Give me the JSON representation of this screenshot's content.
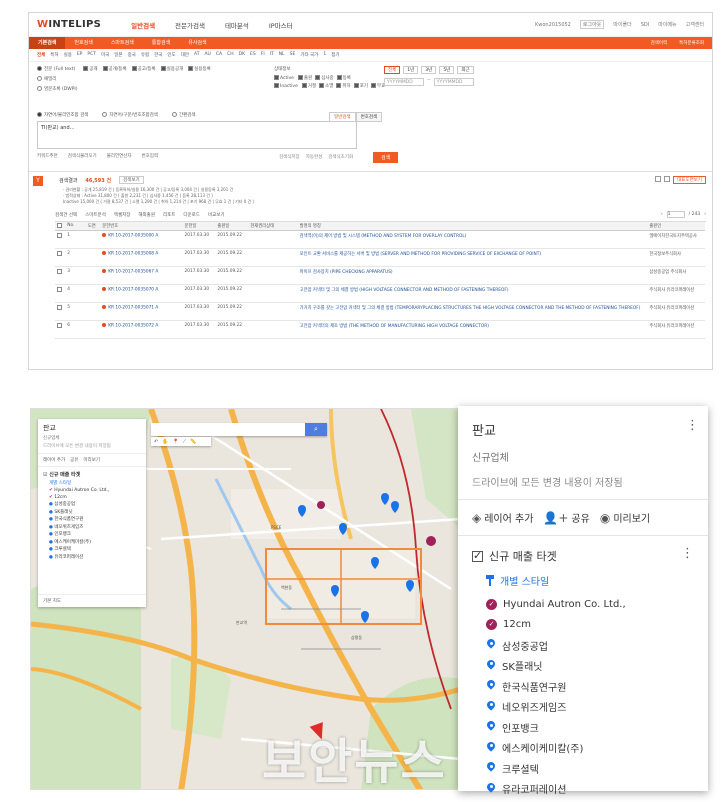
{
  "patent_ui": {
    "logo": {
      "part1": "W",
      "part2": "INTELIPS"
    },
    "gnb": [
      "일반검색",
      "전문가검색",
      "테마분석",
      "IP마스터"
    ],
    "util": [
      "Kwon2015052",
      "로그아웃",
      "마이폴더",
      "SDI",
      "마이메뉴",
      "고객센터"
    ],
    "subtabs": [
      "기본검색",
      "번호검색",
      "스마트검색",
      "통합검색",
      "유사검색"
    ],
    "subtab_right": [
      "검색이력",
      "특허분류조회"
    ],
    "countries": [
      "전체",
      "특허",
      "실용",
      "EP",
      "PCT",
      "미국",
      "일본",
      "중국",
      "유럽",
      "한국",
      "인도",
      "대만",
      "AT",
      "AU",
      "CA",
      "CH",
      "DK",
      "ES",
      "FI",
      "IT",
      "NL",
      "SE",
      "기타 국가",
      "1",
      "접기"
    ],
    "radio_options": [
      "전문 (Full text)",
      "패밀리",
      "영문초록 (DWPI)"
    ],
    "doc_types": [
      "공개",
      "공개/등록",
      "공고/등록",
      "실용공개",
      "실용등록"
    ],
    "status_label": "상태정보",
    "status_rows": [
      {
        "label": "Active",
        "items": [
          "출원",
          "심사중",
          "등록"
        ]
      },
      {
        "label": "Inactive",
        "items": [
          "거절",
          "소멸",
          "취하",
          "포기",
          "무효"
        ]
      }
    ],
    "date_buttons": [
      "전체",
      "1년",
      "3년",
      "5년",
      "최근"
    ],
    "date_from": "YYYYMMDD",
    "date_to": "YYYYMMDD",
    "search_modes": [
      "자연어/불리언조합 검색",
      "자연어/구문/번호조합검색",
      "간편검색"
    ],
    "search_tabs": [
      "일반검색",
      "번호검색"
    ],
    "query": "TI(판교) and…",
    "search_footer": [
      "키워드추천",
      "검색식불러오기",
      "불리언연산자",
      "번호입력"
    ],
    "search_opts": [
      "검색식저장",
      "자동완성",
      "검색식초기화"
    ],
    "search_button": "검색",
    "result_label": "검색결과",
    "result_count": "46,593 건",
    "result_mini": "검색보기",
    "result_detail": [
      "· 권리현황 : 공개 25,819 건 | 등록특허/실용 16,300 건 | 공고/등록 3,004 건 | 실용등록 3,201 건",
      "· 법적상태 : Active 31,800 건 ( 출원 2,231 건 | 심사중 1,456 건 | 등록 28,113 건 )",
      "   Inactive 15,000 건 ( 거절 8,537 건 | 소멸 1,290 건 | 취하 1,214 건 | 포기 968 건 | 무효 1 건 | 기타 0 건 )"
    ],
    "result_tool_btn": "대표도면보기",
    "actions": [
      "검색건 선택",
      "스마트분석",
      "엑셀저장",
      "해외출원",
      "리포트",
      "다운로드",
      "비교보기"
    ],
    "pager": {
      "page": "1",
      "total": "/ 243"
    },
    "columns": [
      "No.",
      "도면",
      "문헌번호",
      "문헌일",
      "출원일",
      "현재권리상태",
      "발명의 명칭",
      "출원인"
    ],
    "rows": [
      {
        "no": "1",
        "num": "KR 10-2017-0035000 A",
        "d1": "2017.03.30",
        "d2": "2015.09.22",
        "title": "검색역(이)의 제어 방법 및 시스템 (METHOD AND SYSTEM FOR OVERLAY CONTROL)",
        "app": "엘에이치한국토지주택공사"
      },
      {
        "no": "2",
        "num": "KR 10-2017-0035008 A",
        "d1": "2017.03.30",
        "d2": "2015.09.22",
        "title": "포인트 교환 서비스를 제공하는 서버 및 방법 (SERVER AND METHOD FOR PROVIDING SERVICE OF EXCHANGE OF POINT)",
        "app": "한국정보주식회사"
      },
      {
        "no": "3",
        "num": "KR 10-2017-0035067 A",
        "d1": "2017.03.30",
        "d2": "2015.09.22",
        "title": "파이프 검사장치 (PIPE CHECKING APPARATUS)",
        "app": "삼성중공업 주식회사"
      },
      {
        "no": "4",
        "num": "KR 10-2017-0035070 A",
        "d1": "2017.03.30",
        "d2": "2015.09.22",
        "title": "고전압 커넥터 및 그의 체결 방법 (HIGH VOLTAGE CONNECTOR AND METHOD OF FASTENING THEREOF)",
        "app": "주식회사 유라코퍼레이션"
      },
      {
        "no": "5",
        "num": "KR 10-2017-0035071 A",
        "d1": "2017.03.30",
        "d2": "2015.09.22",
        "title": "가거치 구조를 갖는 고전압 커넥터 및 그의 체결 방법 (TEMPORARYPLACING STRUCTURES THE HIGH VOLTAGE CONNECTOR AND THE METHOD OF FASTENING THEREOF)",
        "app": "주식회사 유라코퍼레이션"
      },
      {
        "no": "6",
        "num": "KR 10-2017-0035072 A",
        "d1": "2017.03.30",
        "d2": "2015.09.22",
        "title": "고전압 커넥터의 제조 방법 (THE METHOD OF MANUFACTURING HIGH VOLTAGE CONNECTOR)",
        "app": "주식회사 유라코퍼레이션"
      }
    ]
  },
  "map_ui": {
    "tools": [
      "↶",
      "✋",
      "📍",
      "⟋",
      "📏"
    ],
    "panel_title": "판교",
    "panel_sub": "신규업체",
    "panel_save": "드라이브에 모든 변경 내용이 저장됨",
    "panel_actions": [
      "레이어 추가",
      "공유",
      "미리보기"
    ],
    "layer_title": "신규 매출 타겟",
    "layer_style": "개별 스타일",
    "items": [
      {
        "label": "Hyundai Autron Co. Ltd.,",
        "type": "check"
      },
      {
        "label": "12cm",
        "type": "check"
      },
      {
        "label": "삼성중공업",
        "type": "pin"
      },
      {
        "label": "SK플래닛",
        "type": "pin"
      },
      {
        "label": "한국식품연구원",
        "type": "pin"
      },
      {
        "label": "네오위즈게임즈",
        "type": "pin"
      },
      {
        "label": "인포뱅크",
        "type": "pin"
      },
      {
        "label": "에스케이케미칼(주)",
        "type": "pin"
      },
      {
        "label": "크루셜텍",
        "type": "pin"
      },
      {
        "label": "유라코퍼레이션",
        "type": "pin"
      }
    ],
    "base_map": "기본 지도"
  },
  "colors": {
    "brand": "#f15a22",
    "link": "#1c4f9c",
    "pin": "#1a73e8",
    "check": "#a0225a"
  },
  "watermark": "보안뉴스"
}
